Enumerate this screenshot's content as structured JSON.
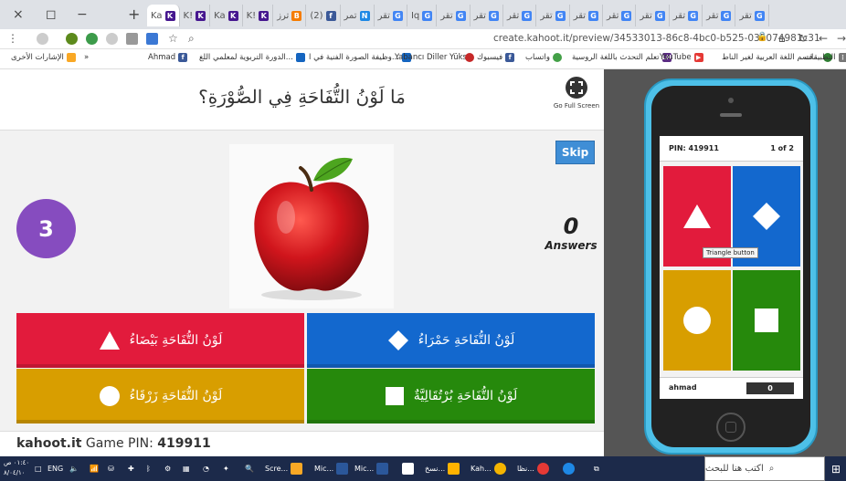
{
  "browser": {
    "window_controls": [
      "×",
      "◻",
      "−"
    ],
    "new_tab": "+",
    "tabs": [
      {
        "label": "Ka",
        "fav": "K",
        "color": "#46178f"
      },
      {
        "label": "K!",
        "fav": "K",
        "color": "#46178f"
      },
      {
        "label": "Ka",
        "fav": "K",
        "color": "#46178f"
      },
      {
        "label": "K!",
        "fav": "K",
        "color": "#46178f"
      },
      {
        "label": "ترز",
        "fav": "B",
        "color": "#f57c00"
      },
      {
        "label": "(2)",
        "fav": "f",
        "color": "#3b5998"
      },
      {
        "label": "تمر",
        "fav": "N",
        "color": "#1e88e5"
      },
      {
        "label": "تقر",
        "fav": "G",
        "color": "#4285f4"
      },
      {
        "label": "Iq",
        "fav": "G",
        "color": "#4285f4"
      },
      {
        "label": "تقر",
        "fav": "G",
        "color": "#4285f4"
      },
      {
        "label": "تقر",
        "fav": "G",
        "color": "#4285f4"
      },
      {
        "label": "تقر",
        "fav": "G",
        "color": "#4285f4"
      },
      {
        "label": "تقر",
        "fav": "G",
        "color": "#4285f4"
      },
      {
        "label": "تقر",
        "fav": "G",
        "color": "#4285f4"
      },
      {
        "label": "تقر",
        "fav": "G",
        "color": "#4285f4"
      },
      {
        "label": "تقر",
        "fav": "G",
        "color": "#4285f4"
      },
      {
        "label": "تقر",
        "fav": "G",
        "color": "#4285f4"
      },
      {
        "label": "تقر",
        "fav": "G",
        "color": "#4285f4"
      },
      {
        "label": "تقر",
        "fav": "G",
        "color": "#4285f4"
      }
    ],
    "url": "create.kahoot.it/preview/34533013-86c8-4bc0-b525-035074981c31"
  },
  "bookmarks": [
    {
      "label": "التطبيقات",
      "color": "#777"
    },
    {
      "label": "قسم اللغة العربية لغير الناط...",
      "color": "#2e7d32"
    },
    {
      "label": "YouTube",
      "color": "#e53935"
    },
    {
      "label": "تعلم التحدث باللغة الروسية",
      "color": "#5b2c83"
    },
    {
      "label": "واتساب",
      "color": "#43a047"
    },
    {
      "label": "فيسبوك",
      "color": "#3b5998"
    },
    {
      "label": "Yabancı Diller Yüks...",
      "color": "#c62828"
    },
    {
      "label": "وظيفة الصورة الفنية في ا...",
      "color": "#1565c0"
    },
    {
      "label": "الدورة التربوية لمعلمي اللغ...",
      "color": "#1565c0"
    },
    {
      "label": "Ahmad",
      "color": "#3b5998"
    },
    {
      "label": "»",
      "color": ""
    },
    {
      "label": "الإشارات الأخرى",
      "color": "#f9a825"
    }
  ],
  "host": {
    "question": "مَا لَوْنُ التُّفَاحَةِ فِي الصُّوْرَةِ؟",
    "fullscreen_label": "Go Full Screen",
    "timer": "3",
    "skip_label": "Skip",
    "answers_count": "0",
    "answers_label": "Answers",
    "options": [
      {
        "text": "لَوْنُ التُّفَاحَةِ بَيْضَاءُ",
        "shape": "triangle",
        "color": "#e21b3c"
      },
      {
        "text": "لَوْنُ التُّفَاحَةِ حَمْرَاءُ",
        "shape": "diamond",
        "color": "#1368ce"
      },
      {
        "text": "لَوْنُ التُّفَاحَةِ زَرْقَاءُ",
        "shape": "circle",
        "color": "#d89e00"
      },
      {
        "text": "لَوْنُ التُّفَاحَةِ بُرْتُقَالِيَّةٌ",
        "shape": "square",
        "color": "#26890c"
      }
    ],
    "footer_site": "kahoot.it",
    "footer_pin_label": "Game PIN:",
    "footer_pin": "419911"
  },
  "phone": {
    "pin_label": "PIN: 419911",
    "progress": "1 of 2",
    "tooltip": "Triangle button",
    "nickname": "ahmad",
    "score": "0"
  },
  "taskbar": {
    "clock_time": "٠١:٤٠ ص",
    "clock_date": "٨/٠٤/١٠",
    "lang": "ENG",
    "search_placeholder": "اكتب هنا للبحث",
    "items": [
      {
        "label": "Scre...",
        "color": "#f9a825"
      },
      {
        "label": "Mic...",
        "color": "#2b579a"
      },
      {
        "label": "Mic...",
        "color": "#2b579a"
      },
      {
        "label": "نسخ...",
        "color": "#ffb300"
      },
      {
        "label": "Kah...",
        "color": "#46178f"
      },
      {
        "label": "نظا...",
        "color": "#e53935"
      }
    ]
  }
}
